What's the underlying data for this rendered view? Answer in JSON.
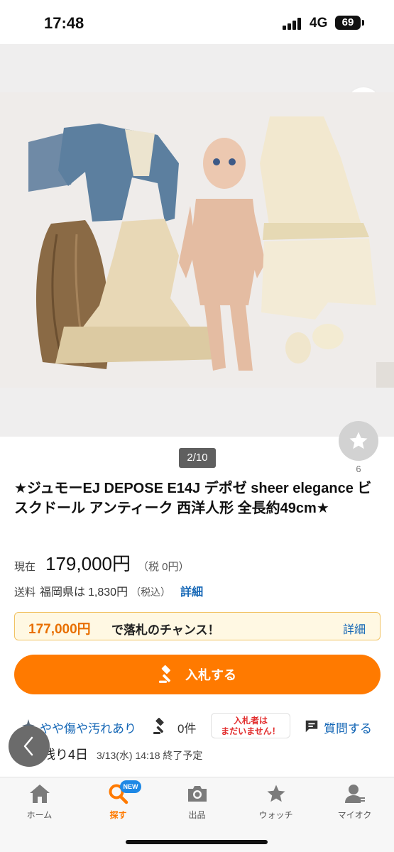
{
  "status_bar": {
    "time": "17:48",
    "network": "4G",
    "battery": "69"
  },
  "gallery": {
    "counter": "2/10",
    "watch_count": "6"
  },
  "item": {
    "title": "★ジュモーEJ DEPOSE E14J デポゼ sheer elegance ビスクドール アンティーク 西洋人形 全長約49cm★",
    "price_label": "現在",
    "price": "179,000円",
    "price_tax": "（税 0円）",
    "shipping_label": "送料",
    "shipping_pref": "福岡県は",
    "shipping_fee": "1,830円",
    "shipping_tax": "（税込）",
    "shipping_detail": "詳細",
    "buyout_price": "177,000円",
    "buyout_text": "で落札のチャンス！",
    "buyout_detail": "詳細",
    "bid_button": "入札する",
    "condition": "やや傷や汚れあり",
    "bid_count": "0件",
    "no_bidder_line1": "入札者は",
    "no_bidder_line2": "まだいません！",
    "question": "質問する",
    "remaining": "残り4日",
    "end_time": "3/13(水) 14:18 終了予定"
  },
  "tabs": [
    {
      "label": "ホーム",
      "icon": "home-icon"
    },
    {
      "label": "探す",
      "icon": "search-icon",
      "badge": "NEW"
    },
    {
      "label": "出品",
      "icon": "camera-icon"
    },
    {
      "label": "ウォッチ",
      "icon": "star-icon"
    },
    {
      "label": "マイオク",
      "icon": "person-icon"
    }
  ],
  "colors": {
    "accent": "#ff7a00",
    "link": "#1567b6",
    "alert": "#e22d2d"
  }
}
